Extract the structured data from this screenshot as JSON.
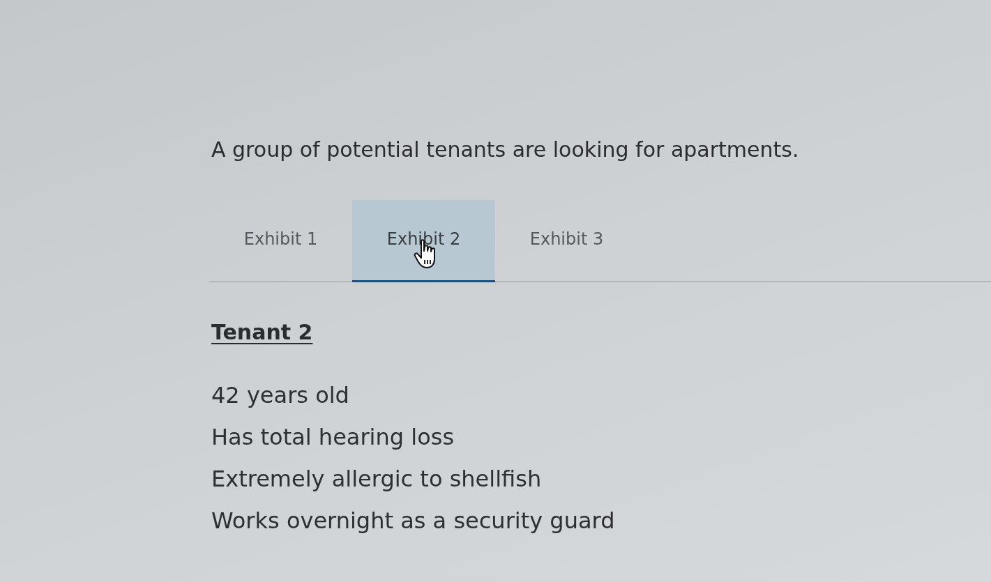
{
  "prompt": "A group of potential tenants are looking for apartments.",
  "tabs": [
    {
      "label": "Exhibit 1",
      "selected": false
    },
    {
      "label": "Exhibit 2",
      "selected": true
    },
    {
      "label": "Exhibit 3",
      "selected": false
    }
  ],
  "panel": {
    "heading": "Tenant 2",
    "lines": [
      "42 years old",
      "Has total hearing loss",
      "Extremely allergic to shellfish",
      "Works overnight as a security guard"
    ]
  }
}
